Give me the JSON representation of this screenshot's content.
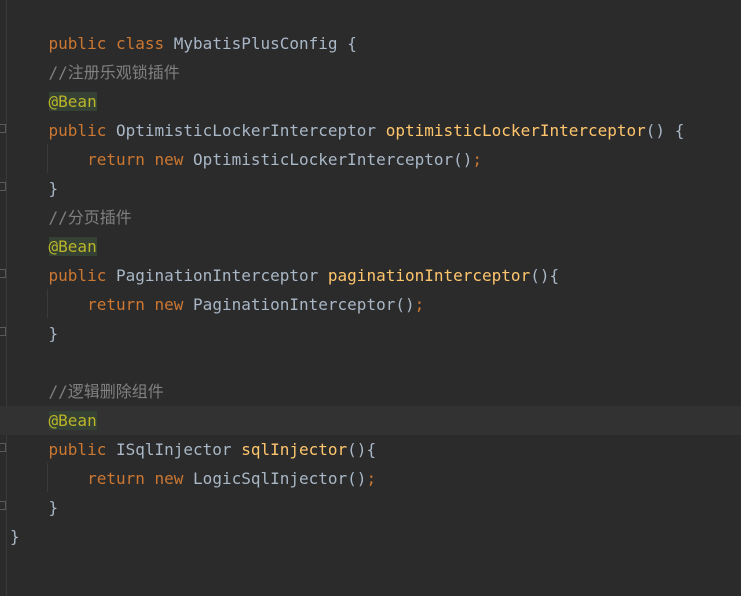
{
  "code": {
    "l1": {
      "kw1": "public",
      "kw2": "class",
      "name": "MybatisPlusConfig",
      "brace": "{"
    },
    "l3": {
      "comment": "//注册乐观锁插件"
    },
    "l4": {
      "annotation": "@Bean"
    },
    "l5": {
      "kw": "public",
      "type": "OptimisticLockerInterceptor",
      "method": "optimisticLockerInterceptor",
      "tail": "() {"
    },
    "l6": {
      "kw1": "return",
      "kw2": "new",
      "ctor": "OptimisticLockerInterceptor",
      "paren": "()",
      "semi": ";"
    },
    "l7": {
      "brace": "}"
    },
    "l8": {
      "comment": "//分页插件"
    },
    "l9": {
      "annotation": "@Bean"
    },
    "l10": {
      "kw": "public",
      "type": "PaginationInterceptor",
      "method": "paginationInterceptor",
      "tail": "(){"
    },
    "l11": {
      "kw1": "return",
      "kw2": "new",
      "ctor": "PaginationInterceptor",
      "paren": "()",
      "semi": ";"
    },
    "l12": {
      "brace": "}"
    },
    "l14": {
      "comment": "//逻辑删除组件"
    },
    "l15": {
      "annotation": "@Bean"
    },
    "l16": {
      "kw": "public",
      "type": "ISqlInjector",
      "method": "sqlInjector",
      "tail": "(){"
    },
    "l17": {
      "kw1": "return",
      "kw2": "new",
      "ctor": "LogicSqlInjector",
      "paren": "()",
      "semi": ";"
    },
    "l18": {
      "brace": "}"
    },
    "l19": {
      "brace": "}"
    }
  },
  "colors": {
    "background": "#2b2b2b",
    "keyword": "#cc7832",
    "method": "#ffc66d",
    "comment": "#808080",
    "annotation": "#bbb529",
    "text": "#a9b7c6"
  }
}
